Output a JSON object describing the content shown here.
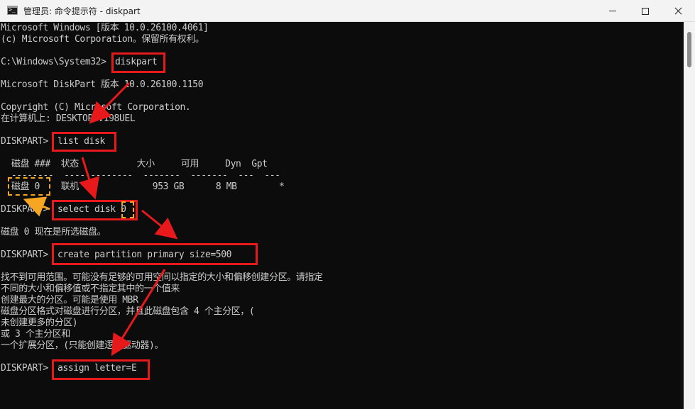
{
  "window": {
    "title": "管理员: 命令提示符 - diskpart",
    "minimize_icon": "minimize-icon",
    "maximize_icon": "maximize-icon",
    "close_icon": "close-icon"
  },
  "console": {
    "lines": [
      "Microsoft Windows [版本 10.0.26100.4061]",
      "(c) Microsoft Corporation。保留所有权利。",
      "",
      "C:\\Windows\\System32>",
      "",
      "Microsoft DiskPart 版本 10.0.26100.1150",
      "",
      "Copyright (C) Microsoft Corporation.",
      "在计算机上: DESKTOP-V198UEL",
      "",
      "DISKPART>",
      "",
      "  磁盘 ###  状态           大小     可用     Dyn  Gpt",
      "  --------  -------------  -------  -------  ---  ---",
      "  磁盘 0    联机              953 GB      8 MB        *",
      "",
      "DISKPART>",
      "",
      "磁盘 0 现在是所选磁盘。",
      "",
      "DISKPART>",
      "",
      "找不到可用范围。可能没有足够的可用空间以指定的大小和偏移创建分区。请指定",
      "不同的大小和偏移值或不指定其中的一个值来",
      "创建最大的分区。可能是使用 MBR",
      "磁盘分区格式对磁盘进行分区，并且此磁盘包含 4 个主分区，(",
      "未创建更多的分区)",
      "或 3 个主分区和",
      "一个扩展分区，(只能创建逻辑驱动器)。",
      "",
      "DISKPART>"
    ],
    "commands": {
      "diskpart": "diskpart",
      "list_disk": "list disk",
      "select_disk": "select disk 0",
      "create_partition": "create partition primary size=500",
      "assign_letter": "assign letter=E"
    }
  },
  "colors": {
    "console_bg": "#0c0c0c",
    "console_text": "#cccccc",
    "titlebar_bg": "#f3f3f3",
    "annotation_red": "#e8191b",
    "annotation_orange": "#f6a623"
  }
}
